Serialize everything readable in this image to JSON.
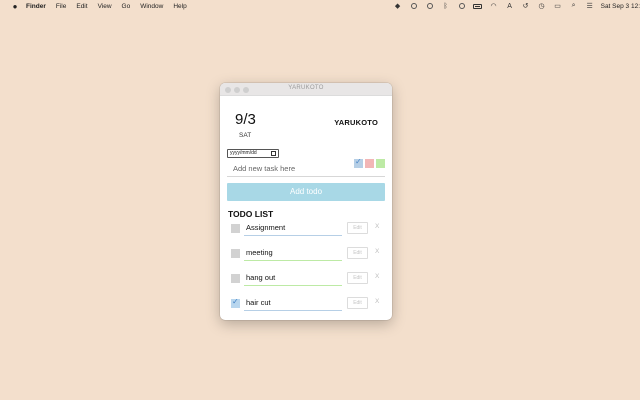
{
  "menubar": {
    "apple_icon": "",
    "items": [
      "Finder",
      "File",
      "Edit",
      "View",
      "Go",
      "Window",
      "Help"
    ],
    "status_icons": [
      "dropbox-icon",
      "record-icon",
      "play-icon",
      "bluetooth-icon",
      "info-icon",
      "battery-icon",
      "wifi-icon",
      "keyboard-icon",
      "history-icon",
      "clock-icon",
      "display-icon",
      "search-icon",
      "control-center-icon"
    ],
    "keyboard_label": "A",
    "clock": "Sat Sep 3  12:"
  },
  "window": {
    "title": "YARUKOTO",
    "date": "9/3",
    "day": "SAT",
    "brand": "YARUKOTO",
    "date_input_placeholder": "yyyy/mm/dd",
    "task_placeholder": "Add new task here",
    "color_options": [
      "#b6cfe6",
      "#f2b6b6",
      "#bdeaa5"
    ],
    "add_button": "Add todo",
    "list_title": "TODO LIST",
    "edit_label": "Edit",
    "delete_label": "X",
    "todos": [
      {
        "text": "Assignment",
        "done": false,
        "color": "#b6cfe6"
      },
      {
        "text": "meeting",
        "done": false,
        "color": "#bdeaa5"
      },
      {
        "text": "hang out",
        "done": false,
        "color": "#bdeaa5"
      },
      {
        "text": "hair cut",
        "done": true,
        "color": "#b6cfe6"
      }
    ]
  }
}
